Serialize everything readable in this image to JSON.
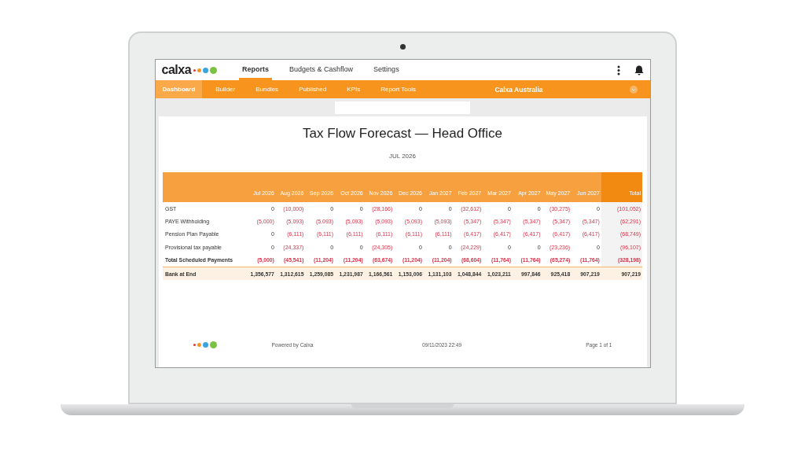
{
  "app": {
    "logo": "calxa",
    "nav": [
      {
        "label": "Reports",
        "selected": true
      },
      {
        "label": "Budgets & Cashflow",
        "selected": false
      },
      {
        "label": "Settings",
        "selected": false
      }
    ],
    "subnav": [
      {
        "label": "Dashboard",
        "selected": true
      },
      {
        "label": "Builder",
        "selected": false
      },
      {
        "label": "Bundles",
        "selected": false
      },
      {
        "label": "Published",
        "selected": false
      },
      {
        "label": "KPIs",
        "selected": false
      },
      {
        "label": "Report Tools",
        "selected": false
      }
    ],
    "organisation": "Calxa Australia"
  },
  "report": {
    "title": "Tax Flow Forecast — Head Office",
    "period": "JUL 2026",
    "columns": [
      "Jul 2026",
      "Aug 2026",
      "Sep 2026",
      "Oct 2026",
      "Nov 2026",
      "Dec 2026",
      "Jan 2027",
      "Feb 2027",
      "Mar 2027",
      "Apr 2027",
      "May 2027",
      "Jun 2027",
      "Total"
    ],
    "rows": [
      {
        "kind": "line",
        "label": "GST",
        "values": [
          "0",
          "(10,000)",
          "0",
          "0",
          "(28,166)",
          "0",
          "0",
          "(32,612)",
          "0",
          "0",
          "(30,275)",
          "0",
          "(101,052)"
        ]
      },
      {
        "kind": "line",
        "label": "PAYE Withholding",
        "values": [
          "(5,000)",
          "(5,093)",
          "(5,093)",
          "(5,093)",
          "(5,093)",
          "(5,093)",
          "(5,093)",
          "(5,347)",
          "(5,347)",
          "(5,347)",
          "(5,347)",
          "(5,347)",
          "(62,291)"
        ]
      },
      {
        "kind": "line",
        "label": "Pension Plan Payable",
        "values": [
          "0",
          "(6,111)",
          "(6,111)",
          "(6,111)",
          "(6,111)",
          "(6,111)",
          "(6,111)",
          "(6,417)",
          "(6,417)",
          "(6,417)",
          "(6,417)",
          "(6,417)",
          "(68,749)"
        ]
      },
      {
        "kind": "line",
        "label": "Provisional tax payable",
        "values": [
          "0",
          "(24,337)",
          "0",
          "0",
          "(24,305)",
          "0",
          "0",
          "(24,229)",
          "0",
          "0",
          "(23,236)",
          "0",
          "(96,107)"
        ]
      },
      {
        "kind": "total",
        "label": "Total Scheduled Payments",
        "values": [
          "(5,000)",
          "(45,541)",
          "(11,204)",
          "(11,204)",
          "(63,674)",
          "(11,204)",
          "(11,204)",
          "(68,604)",
          "(11,764)",
          "(11,764)",
          "(65,274)",
          "(11,764)",
          "(328,198)"
        ]
      },
      {
        "kind": "balance",
        "label": "Bank at End",
        "values": [
          "1,356,577",
          "1,312,615",
          "1,259,085",
          "1,231,987",
          "1,166,561",
          "1,153,006",
          "1,131,103",
          "1,048,844",
          "1,023,211",
          "997,846",
          "925,418",
          "907,219",
          "907,219"
        ]
      }
    ]
  },
  "footer": {
    "powered_by": "Powered by Calxa",
    "timestamp": "09/11/2023 22:49",
    "page": "Page 1 of 1"
  }
}
